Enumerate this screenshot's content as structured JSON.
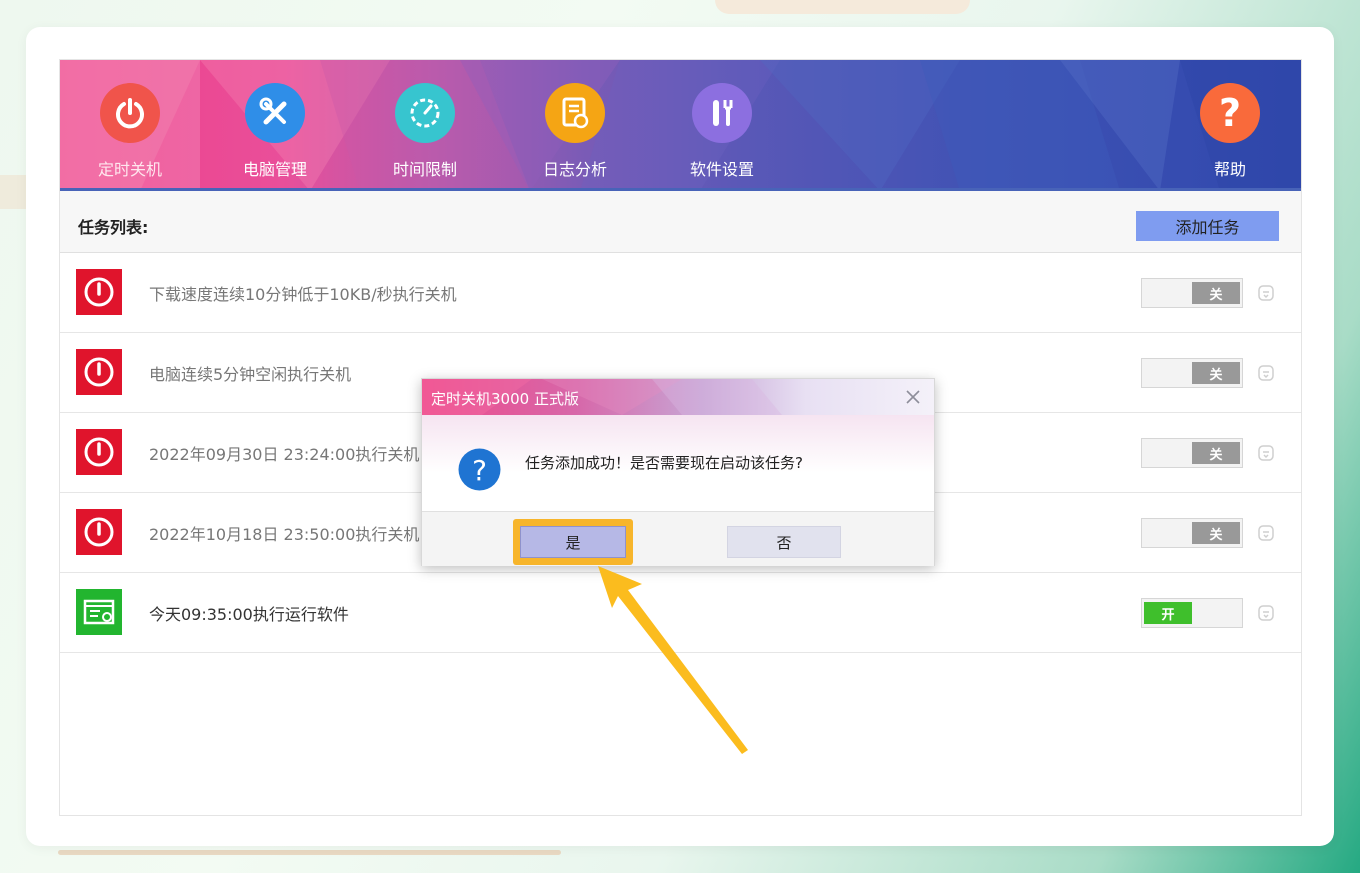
{
  "nav": {
    "tabs": [
      {
        "label": "定时关机",
        "icon": "power-icon",
        "color": "#f0544b",
        "active": true
      },
      {
        "label": "电脑管理",
        "icon": "tools-icon",
        "color": "#2f8ee8",
        "active": false
      },
      {
        "label": "时间限制",
        "icon": "timer-icon",
        "color": "#37c5cf",
        "active": false
      },
      {
        "label": "日志分析",
        "icon": "log-icon",
        "color": "#f5a514",
        "active": false
      },
      {
        "label": "软件设置",
        "icon": "settings-icon",
        "color": "#8c6fe0",
        "active": false
      }
    ],
    "help": {
      "label": "帮助",
      "icon": "help-icon",
      "color": "#f96a3b"
    }
  },
  "task_list": {
    "title": "任务列表:",
    "add_button": "添加任务",
    "rows": [
      {
        "text": "下载速度连续10分钟低于10KB/秒执行关机",
        "icon": "shutdown-icon",
        "toggle": "关",
        "state": "off"
      },
      {
        "text": "电脑连续5分钟空闲执行关机",
        "icon": "shutdown-icon",
        "toggle": "关",
        "state": "off"
      },
      {
        "text": "2022年09月30日 23:24:00执行关机",
        "icon": "shutdown-icon",
        "toggle": "关",
        "state": "off"
      },
      {
        "text": "2022年10月18日 23:50:00执行关机",
        "icon": "shutdown-icon",
        "toggle": "关",
        "state": "off"
      },
      {
        "text": "今天09:35:00执行运行软件",
        "icon": "run-software-icon",
        "toggle": "开",
        "state": "on"
      }
    ]
  },
  "dialog": {
    "title": "定时关机3000 正式版",
    "message": "任务添加成功！是否需要现在启动该任务?",
    "yes": "是",
    "no": "否"
  },
  "colors": {
    "shutdown_red": "#e0142c",
    "run_green": "#22b52f",
    "highlight": "#f7b52b",
    "toggle_on": "#3fbf2c",
    "toggle_off": "#999999"
  }
}
